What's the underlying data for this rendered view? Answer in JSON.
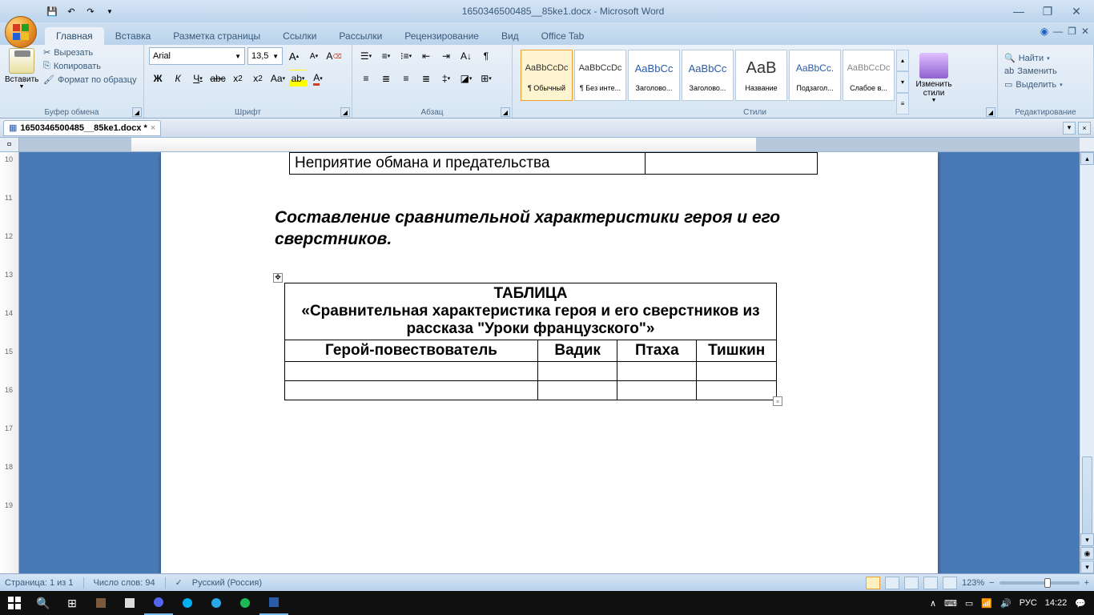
{
  "title": "1650346500485__85ke1.docx - Microsoft Word",
  "tabs": {
    "home": "Главная",
    "insert": "Вставка",
    "layout": "Разметка страницы",
    "refs": "Ссылки",
    "mail": "Рассылки",
    "review": "Рецензирование",
    "view": "Вид",
    "office": "Office Tab"
  },
  "clipboard": {
    "paste": "Вставить",
    "cut": "Вырезать",
    "copy": "Копировать",
    "format": "Формат по образцу",
    "group": "Буфер обмена"
  },
  "font": {
    "name": "Arial",
    "size": "13,5",
    "group": "Шрифт"
  },
  "para": {
    "group": "Абзац"
  },
  "styles": {
    "group": "Стили",
    "items": [
      {
        "preview": "AaBbCcDc",
        "label": "¶ Обычный"
      },
      {
        "preview": "AaBbCcDc",
        "label": "¶ Без инте..."
      },
      {
        "preview": "AaBbCc",
        "label": "Заголово..."
      },
      {
        "preview": "AaBbCc",
        "label": "Заголово..."
      },
      {
        "preview": "АаВ",
        "label": "Название"
      },
      {
        "preview": "AaBbCc.",
        "label": "Подзагол..."
      },
      {
        "preview": "AaBbCcDc",
        "label": "Слабое в..."
      }
    ],
    "change": "Изменить стили"
  },
  "editing": {
    "find": "Найти",
    "replace": "Заменить",
    "select": "Выделить",
    "group": "Редактирование"
  },
  "doctab": "1650346500485__85ke1.docx *",
  "document": {
    "row1": "Неприятие обмана и предательства",
    "para_title": "Составление сравнительной характеристики героя и его сверстников.",
    "table_title1": "ТАБЛИЦА",
    "table_title2": "«Сравнительная характеристика героя и его сверстников из рассказа \"Уроки французского\"»",
    "h1": "Герой-повествователь",
    "h2": "Вадик",
    "h3": "Птаха",
    "h4": "Тишкин"
  },
  "status": {
    "page": "Страница: 1 из 1",
    "words": "Число слов: 94",
    "lang": "Русский (Россия)",
    "zoom": "123%"
  },
  "tray": {
    "lang": "РУС",
    "time": "14:22"
  }
}
